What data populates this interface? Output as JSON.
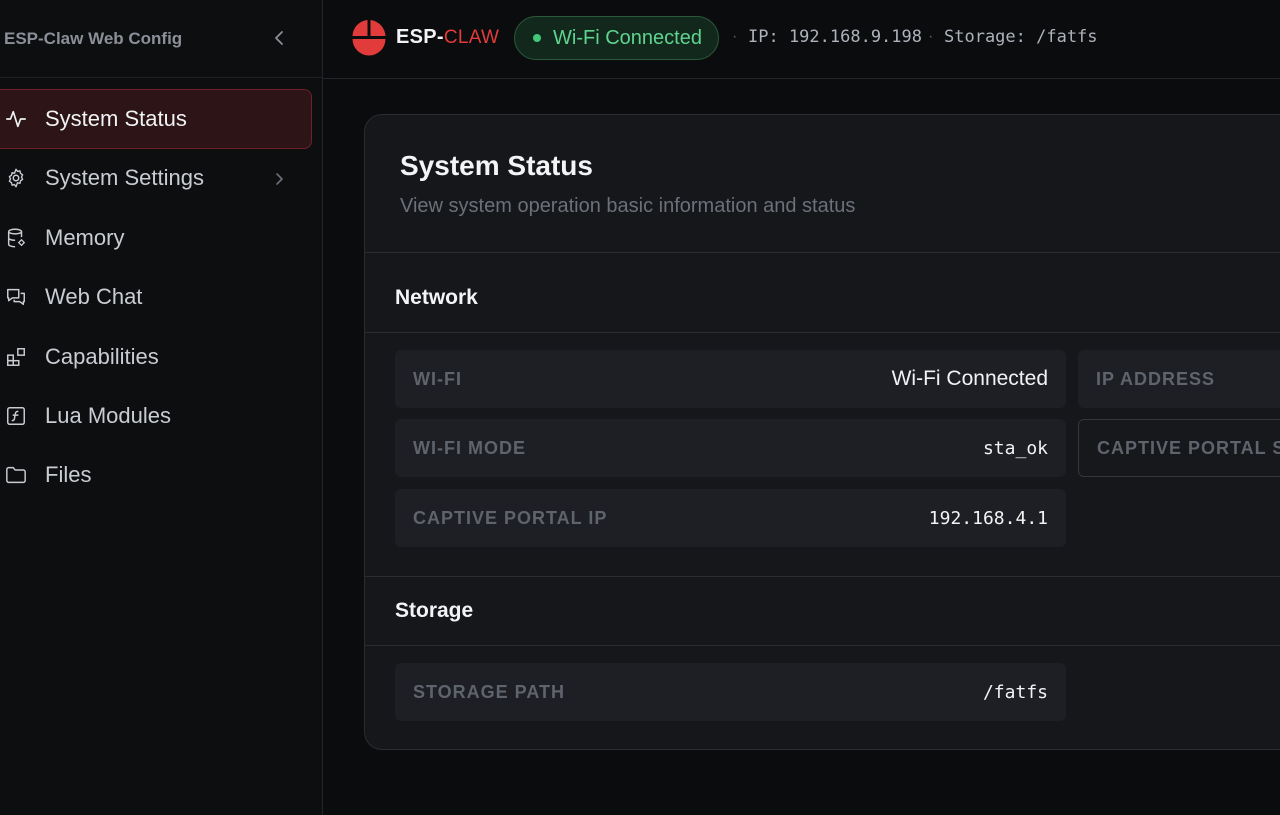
{
  "sidebar": {
    "title": "ESP-Claw Web Config",
    "collapse_icon": "chevron-left-icon",
    "items": [
      {
        "label": "System Status",
        "icon": "activity-icon",
        "active": true
      },
      {
        "label": "System Settings",
        "icon": "gear-icon",
        "has_submenu": true
      },
      {
        "label": "Memory",
        "icon": "database-icon"
      },
      {
        "label": "Web Chat",
        "icon": "chat-bubbles-icon"
      },
      {
        "label": "Capabilities",
        "icon": "blocks-icon"
      },
      {
        "label": "Lua Modules",
        "icon": "function-icon"
      },
      {
        "label": "Files",
        "icon": "folder-icon"
      }
    ]
  },
  "topbar": {
    "brand_main": "ESP-",
    "brand_accent": "CLAW",
    "wifi_status": "Wi-Fi Connected",
    "ip_text": "IP: 192.168.9.198",
    "storage_text": "Storage: /fatfs",
    "separator": "·"
  },
  "panel": {
    "title": "System Status",
    "subtitle": "View system operation basic information and status",
    "network": {
      "title": "Network",
      "wifi": {
        "key": "WI-FI",
        "value": "Wi-Fi Connected"
      },
      "ip_address": {
        "key": "IP ADDRESS",
        "value": ""
      },
      "wifi_mode": {
        "key": "WI-FI MODE",
        "value": "sta_ok"
      },
      "captive_portal_s": {
        "key": "CAPTIVE PORTAL S",
        "value": ""
      },
      "captive_portal_ip": {
        "key": "CAPTIVE PORTAL IP",
        "value": "192.168.4.1"
      }
    },
    "storage": {
      "title": "Storage",
      "path": {
        "key": "STORAGE PATH",
        "value": "/fatfs"
      }
    }
  },
  "colors": {
    "accent_red": "#e23b3b",
    "success_green": "#5fd48f",
    "background": "#0b0c0e",
    "panel": "#16171b"
  }
}
